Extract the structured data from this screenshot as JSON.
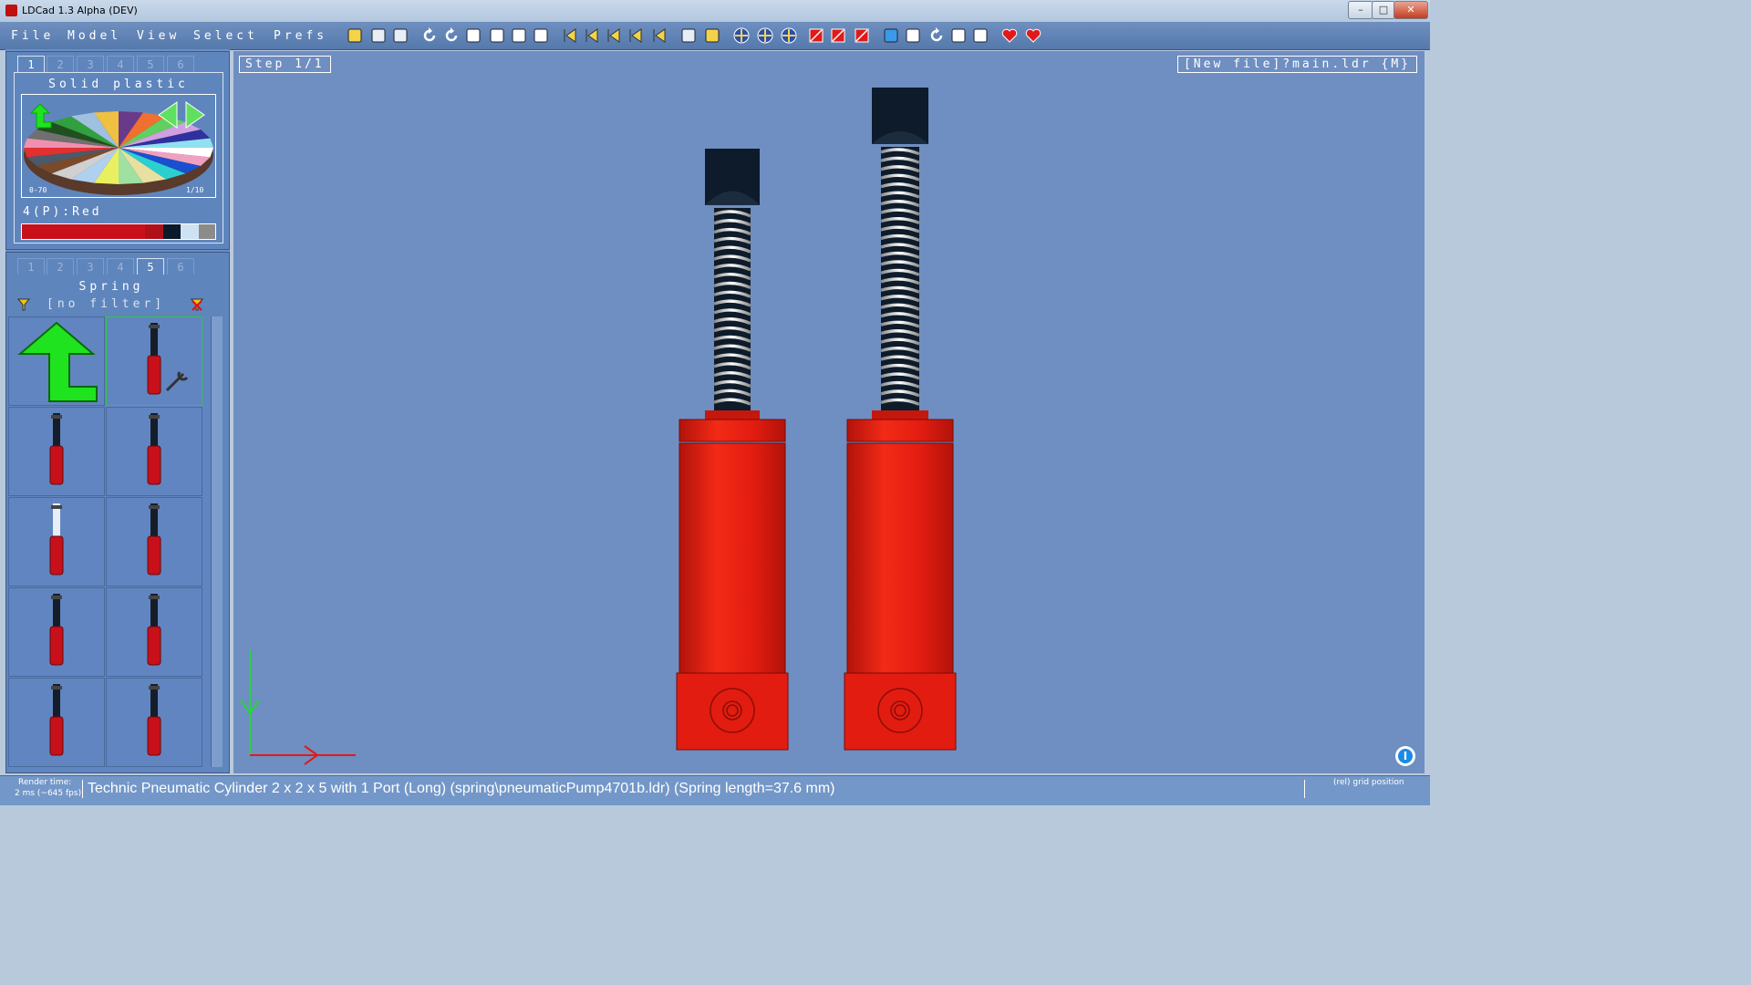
{
  "window": {
    "title": "LDCad 1.3 Alpha (DEV)",
    "minimize": "–",
    "maximize": "□",
    "close": "✕"
  },
  "menu": {
    "items": [
      "File",
      "Model",
      "View",
      "Select",
      "Prefs"
    ]
  },
  "toolbar_icons": [
    "open-file-icon",
    "save-icon",
    "save-all-icon",
    "undo-icon",
    "redo-icon",
    "copy-icon",
    "cut-icon",
    "paste-icon",
    "paste-special-icon",
    "first-step-icon",
    "prev-step-icon",
    "next-step-icon",
    "last-step-icon",
    "add-step-icon",
    "submodel-icon",
    "new-submodel-icon",
    "rotate-pos-icon",
    "move-pos-icon",
    "center-pos-icon",
    "hide-icon",
    "unhide-icon",
    "delete-icon",
    "grid-icon",
    "move-icon",
    "rotate-icon",
    "translate-icon",
    "snap-icon",
    "favorite-icon",
    "favorite-remove-icon"
  ],
  "color_panel": {
    "tabs": [
      "1",
      "2",
      "3",
      "4",
      "5",
      "6"
    ],
    "active_tab": "1",
    "title": "Solid plastic",
    "range_label": "0-70",
    "page_label": "1/10",
    "current_color": "4(P):Red",
    "swatches": [
      "#c8101b",
      "#c8101b",
      "#c8101b",
      "#c8101b",
      "#c8101b",
      "#c8101b",
      "#b0101a",
      "#0b1a2a",
      "#cfe2f3",
      "#8b8b8b"
    ]
  },
  "parts_panel": {
    "tabs": [
      "1",
      "2",
      "3",
      "4",
      "5",
      "6"
    ],
    "active_tab": "5",
    "title": "Spring",
    "filter": "[no filter]",
    "items": [
      {
        "name": "up-folder",
        "selected": false
      },
      {
        "name": "spring-custom",
        "selected": true
      },
      {
        "name": "shock-absorber-1",
        "selected": false
      },
      {
        "name": "shock-absorber-2",
        "selected": false
      },
      {
        "name": "shock-absorber-transparent",
        "selected": false
      },
      {
        "name": "shock-absorber-3",
        "selected": false
      },
      {
        "name": "shock-absorber-4",
        "selected": false
      },
      {
        "name": "shock-absorber-5",
        "selected": false
      },
      {
        "name": "shock-absorber-6",
        "selected": false
      },
      {
        "name": "shock-absorber-7",
        "selected": false
      }
    ]
  },
  "viewport": {
    "step": "Step 1/1",
    "file": "[New file]?main.ldr {M}",
    "bg_color": "#6f8ec1",
    "part_color": "#e21c10"
  },
  "status": {
    "render_label": "Render time:",
    "render_value": "2 ms (~645 fps)",
    "main_text": "Technic Pneumatic Cylinder 2 x 2 x 5 with 1 Port (Long) (spring\\pneumaticPump4701b.ldr) (Spring length=37.6 mm)",
    "grid_label": "(rel) grid position"
  }
}
